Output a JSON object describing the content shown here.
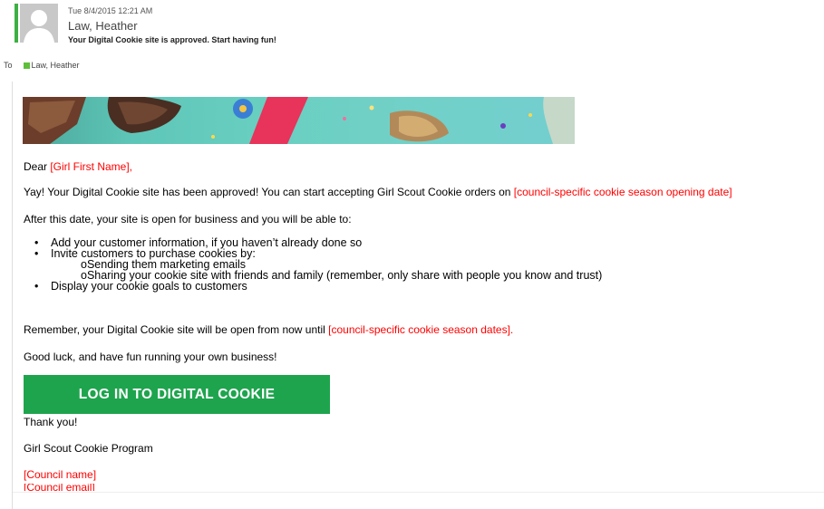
{
  "header": {
    "date": "Tue 8/4/2015 12:21 AM",
    "sender": "Law, Heather",
    "subject": "Your Digital Cookie site is approved. Start having fun!",
    "to_label": "To",
    "to_name": "Law, Heather",
    "presence_color": "#5fbf3a"
  },
  "body": {
    "greeting_prefix": "Dear ",
    "greeting_placeholder": "[Girl First Name],",
    "approved_text": "Yay! Your Digital Cookie site has been approved! You can start accepting Girl Scout Cookie orders on ",
    "approved_placeholder": "[council-specific cookie season opening date]",
    "after_date": "After this date, your site is open for business and you will be able to:",
    "list": [
      "Add your customer information, if you haven’t already done so",
      "Invite customers to purchase cookies by:",
      "Sending them marketing emails",
      "Sharing your cookie site with friends and family (remember, only share with people you know and trust)",
      "Display your cookie goals to customers"
    ],
    "remember_text": "Remember, your Digital Cookie site will be open from now until ",
    "remember_placeholder": "[council-specific cookie season dates].",
    "good_luck": "Good luck, and have fun running your own business!",
    "cta_label": "LOG IN TO DIGITAL COOKIE",
    "cta_color": "#1ea44d",
    "thanks": "Thank you!",
    "signature": "Girl Scout Cookie Program",
    "council_name": "[Council name]",
    "council_email_partial": "[Council email]",
    "placeholder_color": "#ff0000"
  }
}
